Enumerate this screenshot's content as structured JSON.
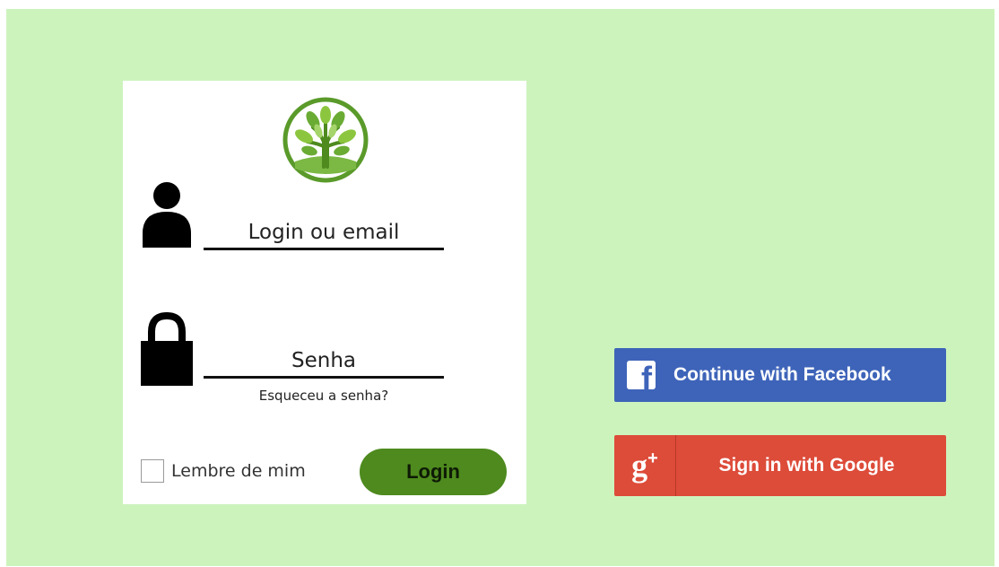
{
  "colors": {
    "background": "#cdf3bd",
    "card": "#ffffff",
    "login_button": "#4e8a1e",
    "facebook": "#3e64b9",
    "google": "#dd4b39"
  },
  "login_form": {
    "logo_icon": "tree-logo-icon",
    "login_placeholder": "Login ou email",
    "password_placeholder": "Senha",
    "forgot_password": "Esqueceu a senha?",
    "remember_me": "Lembre de mim",
    "login_button": "Login"
  },
  "social": {
    "facebook": {
      "icon": "facebook-icon",
      "glyph": "f",
      "label": "Continue with Facebook"
    },
    "google": {
      "icon": "google-plus-icon",
      "glyph": "g",
      "glyph_plus": "+",
      "label": "Sign in with Google"
    }
  }
}
